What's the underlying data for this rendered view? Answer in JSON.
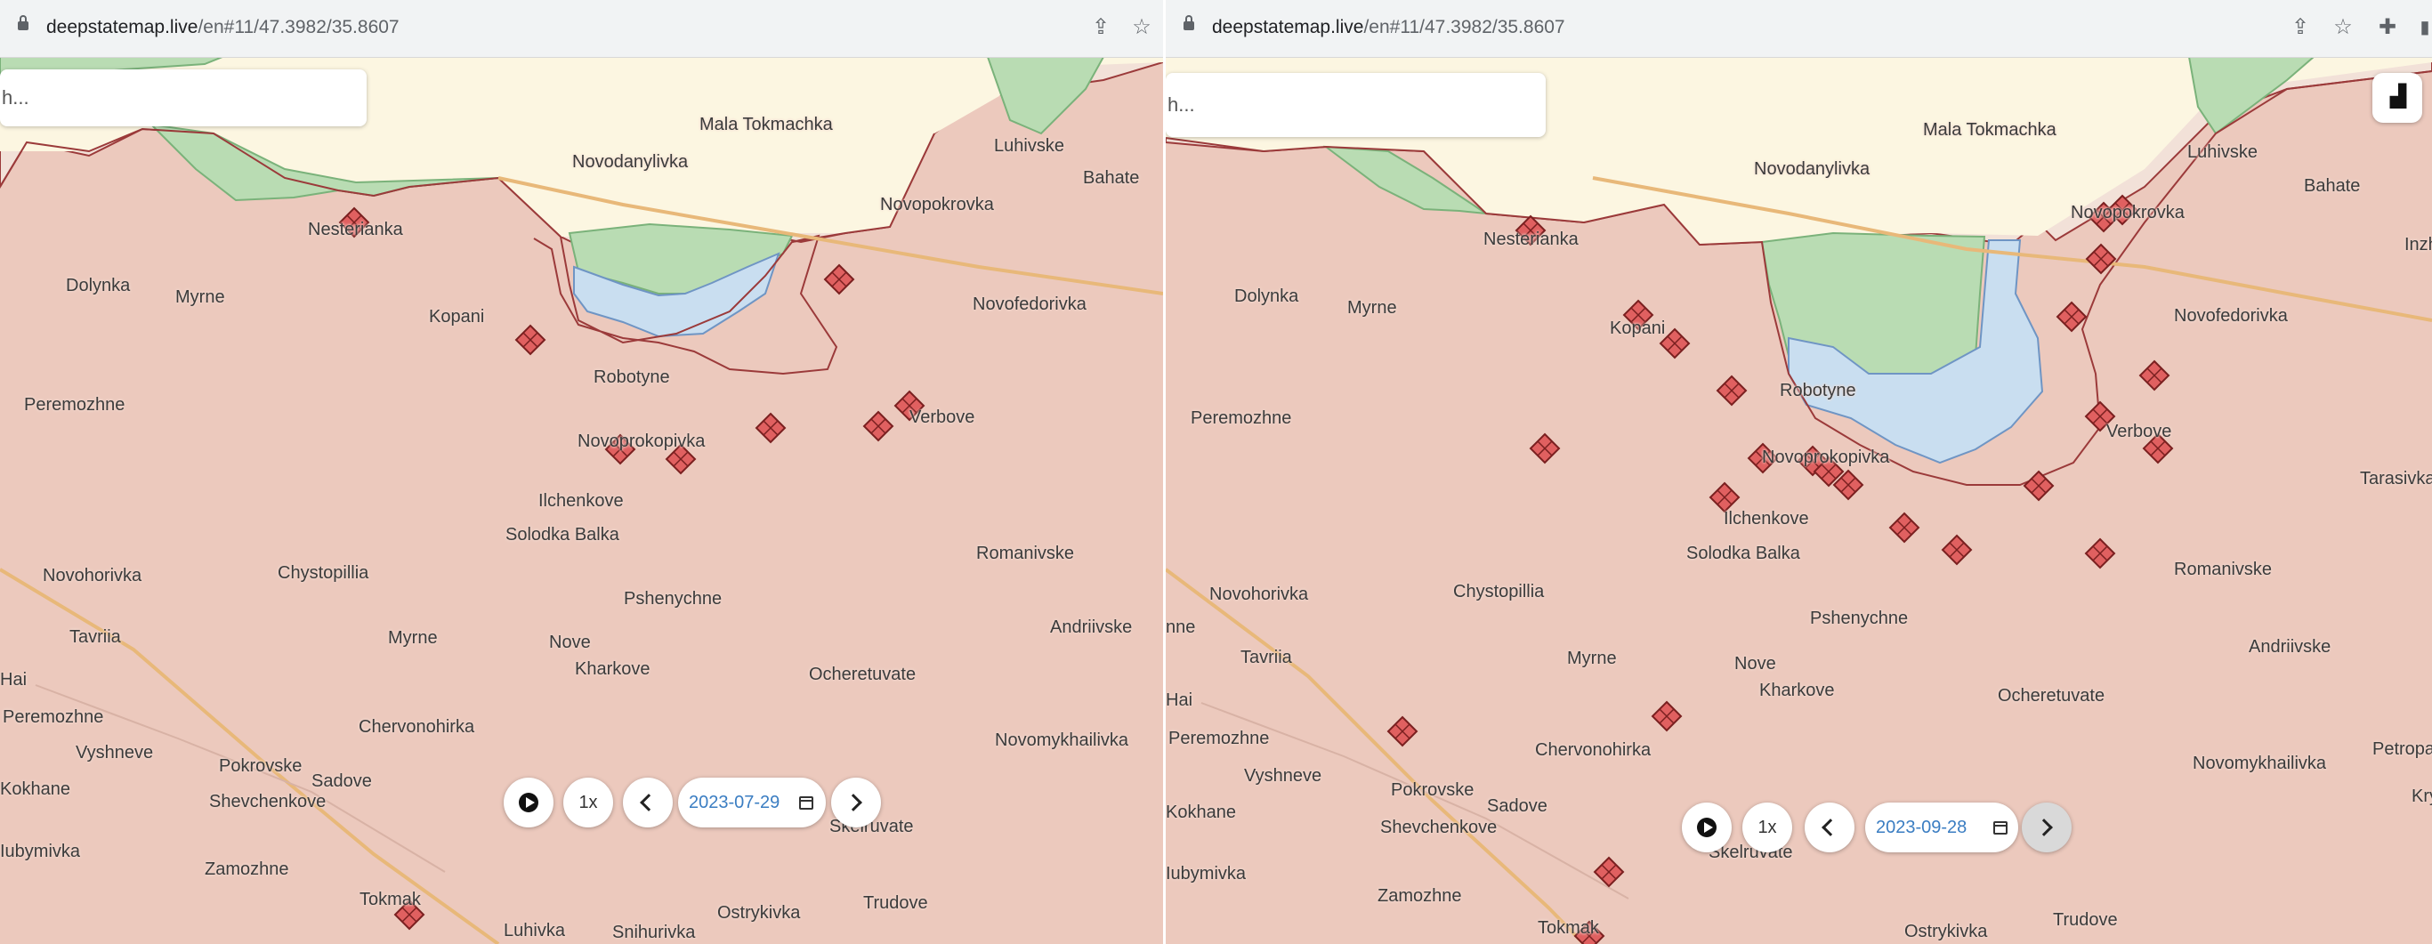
{
  "left": {
    "url": {
      "host": "deepstatemap.live",
      "path": "/en#11/47.3982/35.8607"
    },
    "search_placeholder": "h...",
    "playback": {
      "speed": "1x",
      "date": "2023-07-29"
    },
    "places": [
      "Mala Tokmachka",
      "Luhivske",
      "Novodanylivka",
      "Bahate",
      "Novopokrovka",
      "Nesterianka",
      "Dolynka",
      "Myrne",
      "Novofedorivka",
      "Kopani",
      "Robotyne",
      "Peremozhne",
      "Verbove",
      "Novoprokopivka",
      "Ilchenkove",
      "Solodka Balka",
      "Romanivske",
      "Novohorivka",
      "Chystopillia",
      "Pshenychne",
      "Tavriia",
      "Myrne",
      "Andriivske",
      "Nove",
      "Hai",
      "Kharkove",
      "Ocheretuvate",
      "Peremozhne",
      "Chervonohirka",
      "Novomykhailivka",
      "Vyshneve",
      "Pokrovske",
      "Sadove",
      "Kokhane",
      "Shevchenkove",
      "Skelruvate",
      "Iubymivka",
      "Zamozhne",
      "Tokmak",
      "Trudove",
      "Ostrykivka",
      "Luhivka",
      "Snihurivka",
      "nne"
    ]
  },
  "right": {
    "url": {
      "host": "deepstatemap.live",
      "path": "/en#11/47.3982/35.8607"
    },
    "search_placeholder": "h...",
    "playback": {
      "speed": "1x",
      "date": "2023-09-28"
    },
    "places": [
      "Mala Tokmachka",
      "Luhivske",
      "Novodanylivka",
      "Bahate",
      "Nesterianka",
      "Inzhe",
      "Novopokrovka",
      "Dolynka",
      "Myrne",
      "Novofedorivka",
      "Kopani",
      "Robotyne",
      "Peremozhne",
      "Verbove",
      "Tarasivka",
      "Novoprokopivka",
      "Ilchenkove",
      "Solodka Balka",
      "Romanivske",
      "Novohorivka",
      "Chystopillia",
      "Pshenychne",
      "Andriivske",
      "nne",
      "Tavriia",
      "Myrne",
      "Nove",
      "Hai",
      "Kharkove",
      "Ocheretuvate",
      "Peremozhne",
      "Chervonohirka",
      "Novomykhailivka",
      "Petropa",
      "Vyshneve",
      "Pokrovske",
      "Sadove",
      "Kry",
      "Kokhane",
      "Shevchenkove",
      "Skelruvate",
      "Iubymivka",
      "Zamozhne",
      "Trudove",
      "Tokmak",
      "Ostrykivka"
    ]
  },
  "icons": [
    "lock-icon",
    "share-icon",
    "star-icon",
    "extension-icon",
    "stats-icon",
    "play-icon",
    "calendar-icon",
    "chevron-left-icon",
    "chevron-right-icon",
    "attack-marker-icon"
  ],
  "colors": {
    "occupied": "#ecc9bd",
    "liberated": "#b9dcb3",
    "contested": "#f2e1d8",
    "ukraine": "#fcf6e1",
    "water": "#c9def0",
    "frontline": "#9b3a3a",
    "marker": "#e06060",
    "road": "#e8b879"
  }
}
